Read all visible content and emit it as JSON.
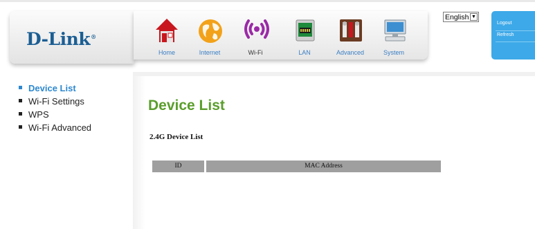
{
  "header": {
    "brand": "D-Link",
    "brand_mark": "®",
    "nav": [
      {
        "label": "Home",
        "icon": "home-icon",
        "active": false
      },
      {
        "label": "Internet",
        "icon": "globe-icon",
        "active": false
      },
      {
        "label": "Wi-Fi",
        "icon": "wifi-icon",
        "active": true
      },
      {
        "label": "LAN",
        "icon": "lan-icon",
        "active": false
      },
      {
        "label": "Advanced",
        "icon": "tools-icon",
        "active": false
      },
      {
        "label": "System",
        "icon": "computer-icon",
        "active": false
      }
    ],
    "language": {
      "selected": "English"
    },
    "account": {
      "logout": "Logout",
      "refresh": "Refresh"
    }
  },
  "sidebar": {
    "items": [
      {
        "label": "Device List",
        "active": true
      },
      {
        "label": "Wi-Fi Settings",
        "active": false
      },
      {
        "label": "WPS",
        "active": false
      },
      {
        "label": "Wi-Fi Advanced",
        "active": false
      }
    ]
  },
  "main": {
    "title": "Device List",
    "section_title": "2.4G Device List",
    "table": {
      "columns": [
        "ID",
        "MAC Address"
      ],
      "rows": []
    }
  },
  "colors": {
    "accent": "#3da9e8",
    "title_green": "#5a9e2b",
    "brand_blue": "#1b5e93"
  }
}
